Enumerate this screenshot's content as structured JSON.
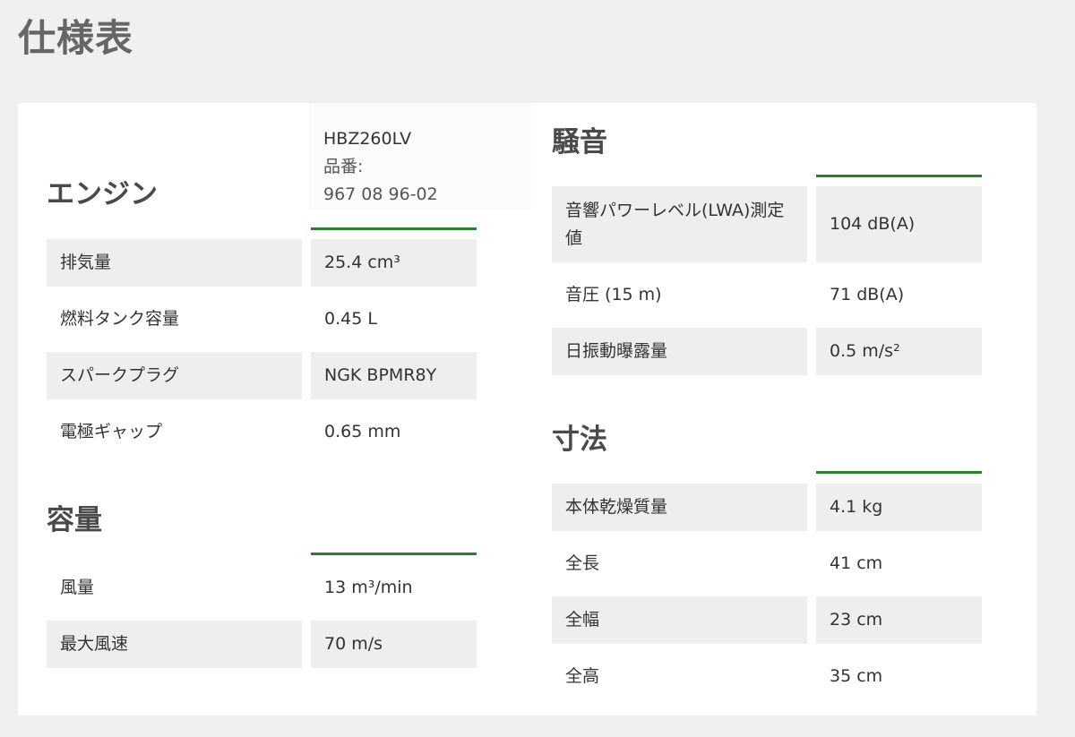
{
  "page_title": "仕様表",
  "model": {
    "name": "HBZ260LV",
    "label": "品番:",
    "number": "967 08 96-02"
  },
  "engine": {
    "title": "エンジン",
    "rows": [
      {
        "label": "排気量",
        "value": "25.4 cm³"
      },
      {
        "label": "燃料タンク容量",
        "value": "0.45 L"
      },
      {
        "label": "スパークプラグ",
        "value": "NGK BPMR8Y"
      },
      {
        "label": "電極ギャップ",
        "value": "0.65 mm"
      }
    ]
  },
  "capacity": {
    "title": "容量",
    "rows": [
      {
        "label": "風量",
        "value": "13 m³/min"
      },
      {
        "label": "最大風速",
        "value": "70 m/s"
      }
    ]
  },
  "noise": {
    "title": "騒音",
    "rows": [
      {
        "label": "音響パワーレベル(LWA)測定値",
        "value": "104 dB(A)"
      },
      {
        "label": "音圧 (15 m)",
        "value": "71 dB(A)"
      },
      {
        "label": "日振動曝露量",
        "value": "0.5 m/s²"
      }
    ]
  },
  "dimensions": {
    "title": "寸法",
    "rows": [
      {
        "label": "本体乾燥質量",
        "value": "4.1 kg"
      },
      {
        "label": "全長",
        "value": "41 cm"
      },
      {
        "label": "全幅",
        "value": "23 cm"
      },
      {
        "label": "全高",
        "value": "35 cm"
      }
    ]
  },
  "colors": {
    "accent_line": "#2e7d2e",
    "row_shade": "#eeeeee",
    "page_background": "#f0f0ef"
  }
}
